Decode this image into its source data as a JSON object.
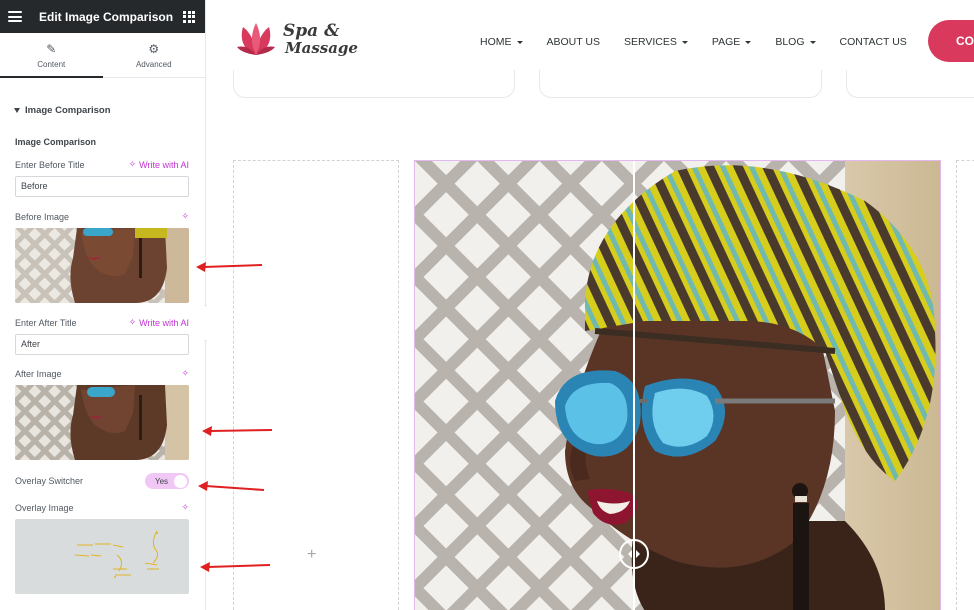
{
  "panel": {
    "title": "Edit Image Comparison",
    "tabs": [
      {
        "label": "Content",
        "icon": "pencil-icon",
        "active": true
      },
      {
        "label": "Advanced",
        "icon": "gear-icon",
        "active": false
      }
    ],
    "section_title": "Image Comparison",
    "subsection_title": "Image Comparison",
    "before_title_label": "Enter Before Title",
    "write_with_ai": "Write with AI",
    "before_title_value": "Before",
    "before_image_label": "Before Image",
    "after_title_label": "Enter After Title",
    "after_title_value": "After",
    "after_image_label": "After Image",
    "overlay_switcher_label": "Overlay Switcher",
    "overlay_switcher_value": "Yes",
    "overlay_image_label": "Overlay Image"
  },
  "site": {
    "logo_line1": "Spa &",
    "logo_line2": "Massage",
    "nav": [
      {
        "label": "HOME",
        "dropdown": true
      },
      {
        "label": "ABOUT US",
        "dropdown": false
      },
      {
        "label": "SERVICES",
        "dropdown": true
      },
      {
        "label": "PAGE",
        "dropdown": true
      },
      {
        "label": "BLOG",
        "dropdown": true
      },
      {
        "label": "CONTACT US",
        "dropdown": false
      }
    ],
    "cta_label": "CO"
  },
  "colors": {
    "panel_header": "#26292c",
    "ai_accent": "#c036d1",
    "toggle_on": "#f1c7f6",
    "cta": "#d8395c",
    "arrow": "#e02020"
  }
}
